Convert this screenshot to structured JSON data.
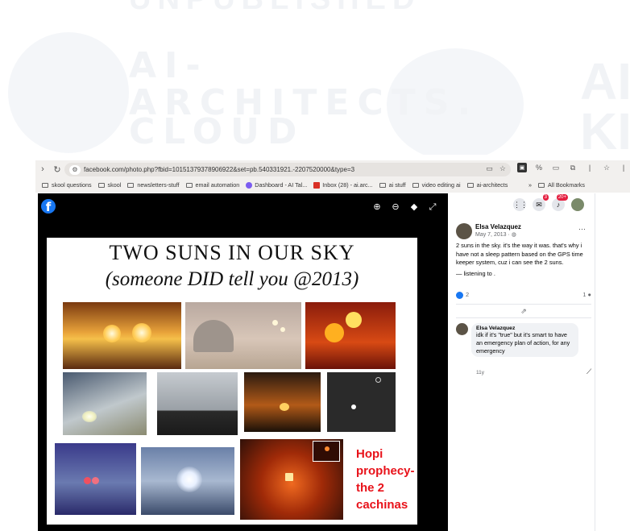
{
  "banner": {
    "line_top": "UNPUBLISHED",
    "line1": "AI-",
    "line2": "ARCHITECTS.",
    "line3": "CLOUD",
    "right": "AI KI"
  },
  "browser": {
    "url_display": "facebook.com/photo.php?fbid=10151379378906922&set=pb.540331921.-2207520000&type=3",
    "bookmarks": [
      {
        "label": "skool questions"
      },
      {
        "label": "skool"
      },
      {
        "label": "newsletters-stuff"
      },
      {
        "label": "email automation"
      },
      {
        "label": "Dashboard - AI Tal..."
      },
      {
        "label": "Inbox (28) - ai.arc..."
      },
      {
        "label": "ai stuff"
      },
      {
        "label": "video editing ai"
      },
      {
        "label": "ai-architects"
      }
    ],
    "overflow": "»",
    "all_bookmarks": "All Bookmarks"
  },
  "photo": {
    "title": "TWO SUNS IN OUR SKY",
    "subtitle": "(someone DID tell you @2013)",
    "hopi_caption": "Hopi prophecy-the 2 cachinas"
  },
  "notifications": {
    "messenger_badge": "3",
    "bell_badge": "20+"
  },
  "post": {
    "author": "Elsa Velazquez",
    "date": "May 7, 2013 · ",
    "text": "2 suns in the sky. it's the way it was. that's why i have not a sleep pattern based on the GPS time keeper system, cuz i can see the 2 suns.",
    "listening": "— listening to .",
    "likes": "2",
    "comments": "1"
  },
  "comment": {
    "author": "Elsa Velazquez",
    "text": "idk if it's \"true\" but it's smart to have an emergency plan of action, for any emergency",
    "time": "11y"
  },
  "colors": {
    "facebook_blue": "#1877f2",
    "badge_red": "#e41e3f",
    "hopi_red": "#e8121a"
  }
}
